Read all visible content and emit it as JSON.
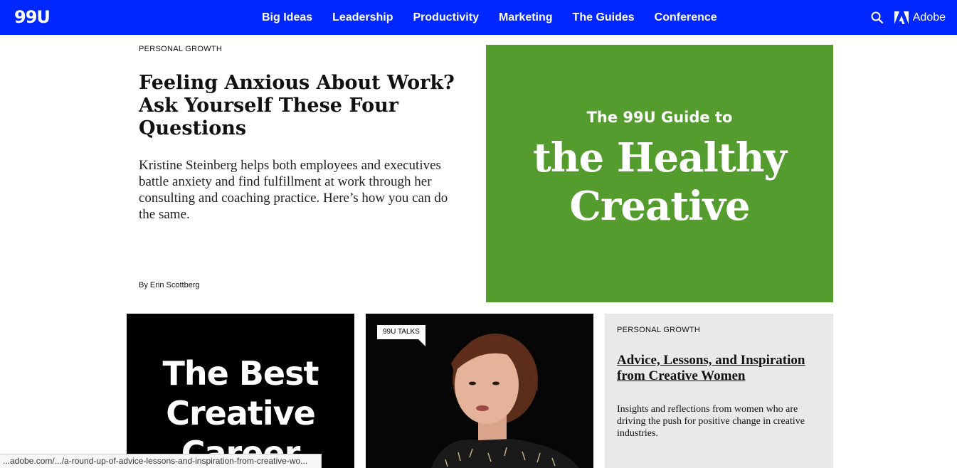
{
  "header": {
    "logo": "99U",
    "nav": [
      "Big Ideas",
      "Leadership",
      "Productivity",
      "Marketing",
      "The Guides",
      "Conference"
    ],
    "adobe_label": "Adobe",
    "icons": {
      "search": "search-icon",
      "adobe": "adobe-logo-icon"
    }
  },
  "hero": {
    "kicker": "PERSONAL GROWTH",
    "title": "Feeling Anxious About Work? Ask Yourself These Four Questions",
    "dek": "Kristine Steinberg helps both employees and executives battle anxiety and find fulfillment at work through her consulting and coaching practice. Here’s how you can do the same.",
    "byline": "By Erin Scottberg"
  },
  "promo": {
    "sub": "The 99U Guide to",
    "title_line1": "the Healthy",
    "title_line2": "Creative",
    "bg": "#559c2e"
  },
  "cards": {
    "card1": {
      "line1": "The Best",
      "line2": "Creative",
      "line3": "Career"
    },
    "card2": {
      "badge": "99U TALKS"
    },
    "card3": {
      "kicker": "PERSONAL GROWTH",
      "title": "Advice, Lessons, and Inspiration from Creative Women",
      "dek": "Insights and reflections from women who are driving the push for positive change in creative industries."
    }
  },
  "status_bar": {
    "url": "...adobe.com/.../a-round-up-of-advice-lessons-and-inspiration-from-creative-wo..."
  },
  "colors": {
    "nav_bg": "#0027ff",
    "card_grey": "#e9e9e9"
  }
}
